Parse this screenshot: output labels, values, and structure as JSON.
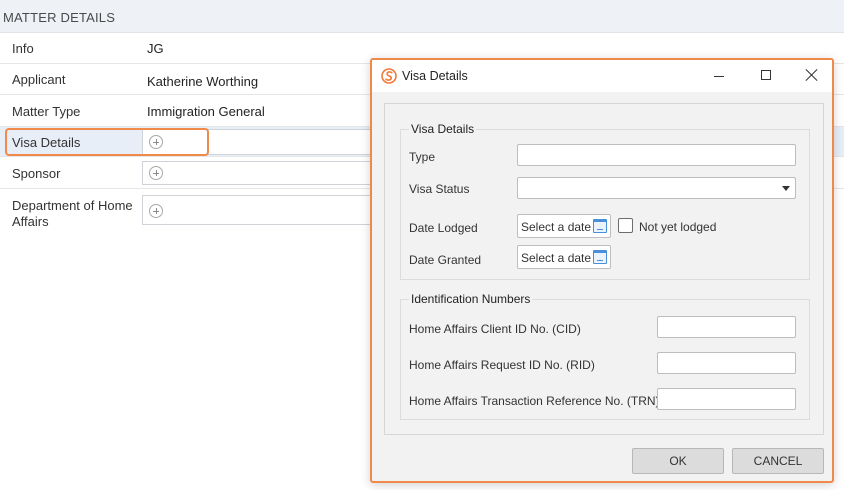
{
  "matter": {
    "header": "MATTER DETAILS",
    "rows": [
      {
        "label": "Info",
        "value": "JG"
      },
      {
        "label": "Applicant",
        "value": "Katherine Worthing"
      },
      {
        "label": "Matter Type",
        "value": "Immigration General"
      },
      {
        "label": "Visa Details",
        "value": ""
      },
      {
        "label": "Sponsor",
        "value": ""
      },
      {
        "label": "Department of Home Affairs",
        "value": ""
      }
    ]
  },
  "dialog": {
    "title": "Visa Details",
    "logo_icon": "s-logo-icon",
    "visa_group": {
      "title": "Visa Details",
      "type_label": "Type",
      "type_value": "",
      "status_label": "Visa Status",
      "status_value": "",
      "date_lodged_label": "Date Lodged",
      "date_lodged_placeholder": "Select a date",
      "not_lodged_label": "Not yet lodged",
      "date_granted_label": "Date Granted",
      "date_granted_placeholder": "Select a date"
    },
    "id_group": {
      "title": "Identification Numbers",
      "cid_label": "Home Affairs Client ID No. (CID)",
      "cid_value": "",
      "rid_label": "Home Affairs Request ID No. (RID)",
      "rid_value": "",
      "trn_label": "Home Affairs Transaction Reference No. (TRN)",
      "trn_value": ""
    },
    "buttons": {
      "ok": "OK",
      "cancel": "CANCEL"
    }
  },
  "colors": {
    "highlight": "#f08a4b",
    "selected_row": "#e8eef7",
    "calendar": "#4a90d9"
  }
}
